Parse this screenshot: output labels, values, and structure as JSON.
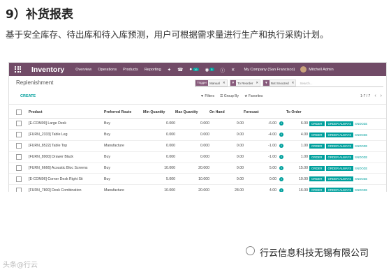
{
  "article": {
    "heading": "9）补货报表",
    "paragraph": "基于安全库存、待出库和待入库预测，用户可根据需求量进行生产和执行采购计划。"
  },
  "topbar": {
    "app_name": "Inventory",
    "menus": [
      "Overview",
      "Operations",
      "Products",
      "Reporting"
    ],
    "chat_badge": "16",
    "activity_badge": "5",
    "company": "My Company (San Francisco)",
    "user": "Mitchell Admin"
  },
  "control_panel": {
    "breadcrumb": "Replenishment",
    "create_label": "CREATE",
    "facets": [
      {
        "tag": "Trigger",
        "value": "Manual"
      },
      {
        "tag": "▼",
        "value": "To Reorder"
      },
      {
        "tag": "▼",
        "value": "Not Snoozed"
      }
    ],
    "search_placeholder": "Search...",
    "filters_label": "Filters",
    "groupby_label": "Group By",
    "favorites_label": "Favorites",
    "pager": "1-7 / 7"
  },
  "table": {
    "columns": [
      "Product",
      "Preferred Route",
      "Min Quantity",
      "Max Quantity",
      "On Hand",
      "Forecast",
      "To Order"
    ],
    "rows": [
      {
        "product": "[E-COM09] Large Desk",
        "route": "Buy",
        "min": "0.000",
        "max": "0.000",
        "onhand": "0.00",
        "forecast": "-6.00",
        "to_order": "6.00"
      },
      {
        "product": "[FURN_2333] Table Leg",
        "route": "Buy",
        "min": "0.000",
        "max": "0.000",
        "onhand": "0.00",
        "forecast": "-4.00",
        "to_order": "4.00"
      },
      {
        "product": "[FURN_8522] Table Top",
        "route": "Manufacture",
        "min": "0.000",
        "max": "0.000",
        "onhand": "0.00",
        "forecast": "-1.00",
        "to_order": "1.00"
      },
      {
        "product": "[FURN_8900] Drawer Black",
        "route": "Buy",
        "min": "0.000",
        "max": "0.000",
        "onhand": "0.00",
        "forecast": "-1.00",
        "to_order": "1.00"
      },
      {
        "product": "[FURN_6666] Acoustic Bloc Screens",
        "route": "Buy",
        "min": "10.000",
        "max": "20.000",
        "onhand": "0.00",
        "forecast": "5.00",
        "to_order": "15.00"
      },
      {
        "product": "[E-COM06] Corner Desk Right Sit",
        "route": "Buy",
        "min": "5.000",
        "max": "10.000",
        "onhand": "0.00",
        "forecast": "0.00",
        "to_order": "10.00"
      },
      {
        "product": "[FURN_7800] Desk Combination",
        "route": "Manufacture",
        "min": "10.000",
        "max": "20.000",
        "onhand": "28.00",
        "forecast": "4.00",
        "to_order": "16.00"
      }
    ],
    "btn_order": "ORDER",
    "btn_order_always": "ORDER ALWAYS",
    "btn_snooze": "SNOOZE"
  },
  "footer": {
    "watermark": "行云信息科技无锡有限公司",
    "left_watermark": "头条@行云"
  },
  "colors": {
    "brand": "#714b67",
    "accent": "#00a09d"
  }
}
